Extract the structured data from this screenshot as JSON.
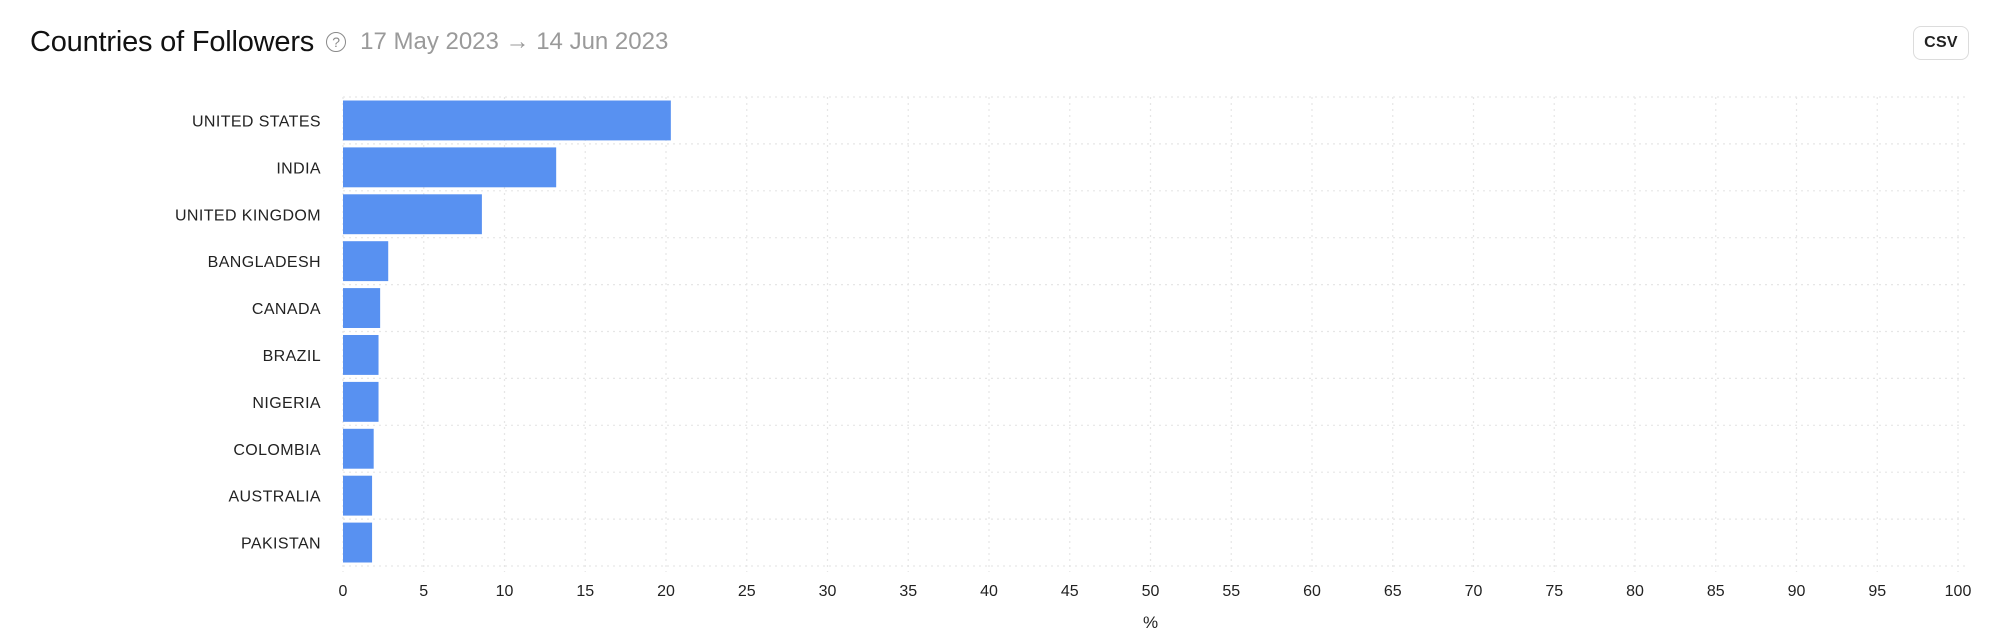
{
  "header": {
    "title": "Countries of Followers",
    "help_icon": "question-circle-icon",
    "help_glyph": "?",
    "date_range": "17 May 2023 → 14 Jun 2023"
  },
  "toolbar": {
    "csv_label": "CSV"
  },
  "colors": {
    "bar": "#5891f1",
    "grid": "#e6e6e6"
  },
  "chart_data": {
    "type": "bar",
    "orientation": "horizontal",
    "title": "Countries of Followers",
    "categories": [
      "UNITED STATES",
      "INDIA",
      "UNITED KINGDOM",
      "BANGLADESH",
      "CANADA",
      "BRAZIL",
      "NIGERIA",
      "COLOMBIA",
      "AUSTRALIA",
      "PAKISTAN"
    ],
    "values": [
      20.3,
      13.2,
      8.6,
      2.8,
      2.3,
      2.2,
      2.2,
      1.9,
      1.8,
      1.8
    ],
    "xlabel": "%",
    "ylabel": "",
    "xlim": [
      0,
      100
    ],
    "xticks": [
      "0",
      "5",
      "10",
      "15",
      "20",
      "25",
      "30",
      "35",
      "40",
      "45",
      "50",
      "55",
      "60",
      "65",
      "70",
      "75",
      "80",
      "85",
      "90",
      "95",
      "100"
    ],
    "grid": true,
    "legend": "none"
  }
}
